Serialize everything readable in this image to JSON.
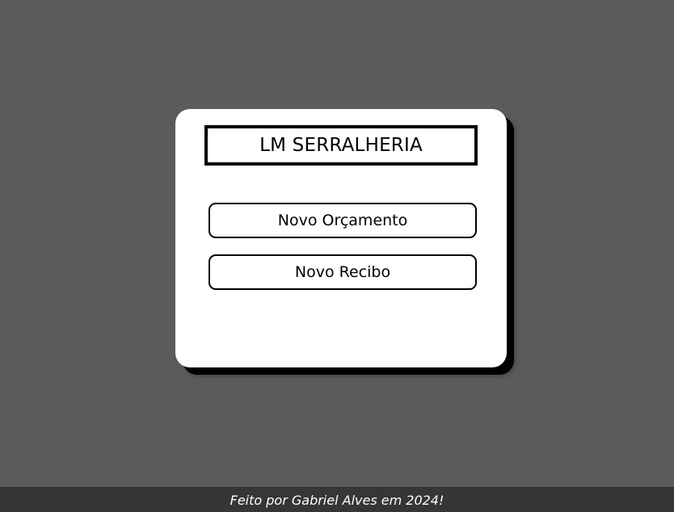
{
  "header": {
    "title": "LM SERRALHERIA"
  },
  "actions": {
    "new_quote_label": "Novo Orçamento",
    "new_receipt_label": "Novo Recibo"
  },
  "footer": {
    "text": "Feito por Gabriel Alves em 2024!"
  },
  "colors": {
    "background": "#5b5b5b",
    "card": "#ffffff",
    "border": "#000000",
    "footer_background": "#363636",
    "footer_text": "#ffffff"
  }
}
